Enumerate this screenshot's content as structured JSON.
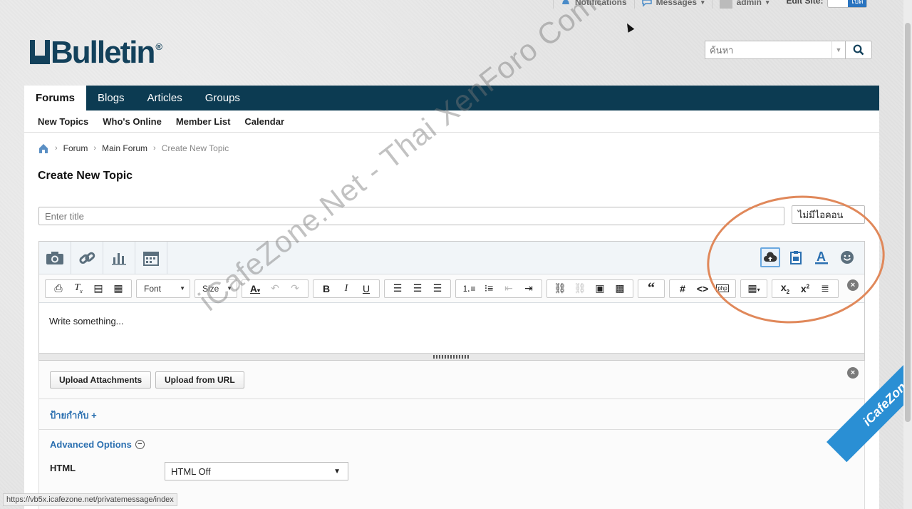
{
  "topbar": {
    "notifications": "Notifications",
    "messages": "Messages",
    "user": "admin",
    "edit_site": "Edit Site:",
    "toggle_state": "เปิด"
  },
  "logo": {
    "text": "Bulletin",
    "prefix": "v",
    "reg": "®"
  },
  "search": {
    "placeholder": "ค้นหา"
  },
  "nav": {
    "tabs": [
      {
        "label": "Forums",
        "active": true
      },
      {
        "label": "Blogs"
      },
      {
        "label": "Articles"
      },
      {
        "label": "Groups"
      }
    ],
    "subnav": [
      "New Topics",
      "Who's Online",
      "Member List",
      "Calendar"
    ]
  },
  "breadcrumb": {
    "items": [
      "Forum",
      "Main Forum"
    ],
    "current": "Create New Topic"
  },
  "page_title": "Create New Topic",
  "title_input": {
    "placeholder": "Enter title"
  },
  "icon_select": {
    "value": "ไม่มีไอคอน"
  },
  "editor": {
    "top_icons": [
      "camera-icon",
      "link-icon",
      "chart-icon",
      "calendar-icon"
    ],
    "right_icons": [
      "upload-cloud-icon",
      "paste-icon",
      "font-color-icon",
      "smiley-icon"
    ],
    "font_label": "Font",
    "size_label": "Size",
    "body_placeholder": "Write something..."
  },
  "attachments": {
    "upload_label": "Upload Attachments",
    "url_label": "Upload from URL"
  },
  "tags_label": "ป้ายกำกับ +",
  "advanced": {
    "heading": "Advanced Options",
    "html_label": "HTML",
    "html_value": "HTML Off"
  },
  "status_url": "https://vb5x.icafezone.net/privatemessage/index",
  "watermark": "iCafeZone.Net - Thai XenForo Community",
  "corner_badge": "iCafeZone"
}
